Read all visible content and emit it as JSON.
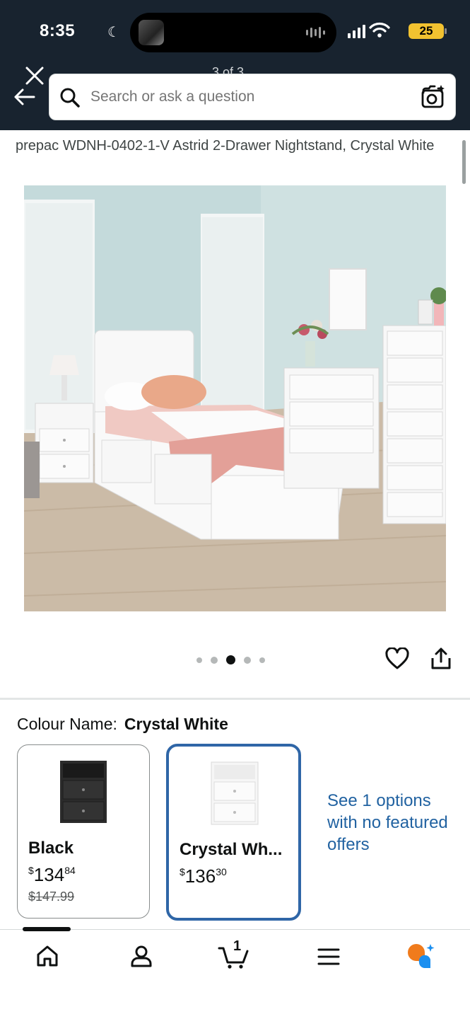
{
  "status_bar": {
    "time": "8:35",
    "battery": "25"
  },
  "header": {
    "page_counter": "3 of 3",
    "search_placeholder": "Search or ask a question"
  },
  "product": {
    "title": "prepac WDNH-0402-1-V Astrid 2-Drawer Nightstand, Crystal White",
    "image_count": 5,
    "active_image_index": 2
  },
  "colour": {
    "label": "Colour Name:",
    "selected_value": "Crystal White",
    "options": [
      {
        "name": "Black",
        "price_whole": "134",
        "price_fraction": "84",
        "currency": "$",
        "was_price": "$147.99",
        "selected": false,
        "swatch_color": "#2b2b2b"
      },
      {
        "name": "Crystal Wh...",
        "price_whole": "136",
        "price_fraction": "30",
        "currency": "$",
        "was_price": "",
        "selected": true,
        "swatch_color": "#f4f4f4"
      }
    ],
    "see_options_link": "See 1 options with no featured offers"
  },
  "bottom_nav": {
    "cart_count": "1",
    "items": [
      "home-icon",
      "account-icon",
      "cart-icon",
      "menu-icon",
      "rufus-icon"
    ]
  },
  "colors": {
    "header_bg": "#18232f",
    "link": "#2162a1",
    "selected_border": "#2f66a7"
  }
}
